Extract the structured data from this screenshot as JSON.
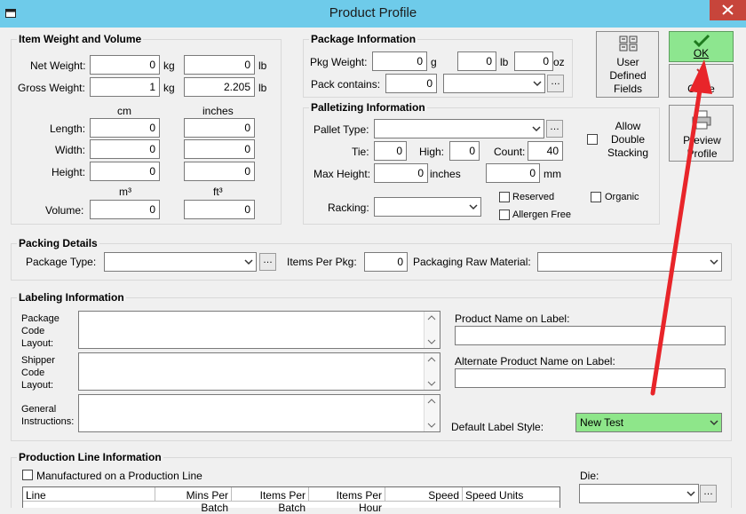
{
  "window": {
    "title": "Product Profile"
  },
  "item_weight": {
    "title": "Item Weight and Volume",
    "net_label": "Net Weight:",
    "net_kg": "0",
    "net_lb": "0",
    "gross_label": "Gross Weight:",
    "gross_kg": "1",
    "gross_lb": "2.205",
    "kg": "kg",
    "lb": "lb",
    "cm": "cm",
    "inches": "inches",
    "length_label": "Length:",
    "length_cm": "0",
    "length_in": "0",
    "width_label": "Width:",
    "width_cm": "0",
    "width_in": "0",
    "height_label": "Height:",
    "height_cm": "0",
    "height_in": "0",
    "m3": "m³",
    "ft3": "ft³",
    "volume_label": "Volume:",
    "volume_m3": "0",
    "volume_ft3": "0"
  },
  "package_info": {
    "title": "Package Information",
    "pkg_weight_label": "Pkg Weight:",
    "g_val": "0",
    "g": "g",
    "lb_val": "0",
    "lb": "lb",
    "oz_val": "0",
    "oz": "oz",
    "pack_contains_label": "Pack contains:",
    "pack_contains_val": "0"
  },
  "palletizing": {
    "title": "Palletizing Information",
    "pallet_type_label": "Pallet Type:",
    "allow_double": "Allow Double Stacking",
    "tie_label": "Tie:",
    "tie_val": "0",
    "high_label": "High:",
    "high_val": "0",
    "count_label": "Count:",
    "count_val": "40",
    "max_height_label": "Max Height:",
    "max_height_in": "0",
    "inches": "inches",
    "max_height_mm": "0",
    "mm": "mm",
    "racking_label": "Racking:",
    "reserved": "Reserved",
    "organic": "Organic",
    "allergen_free": "Allergen Free"
  },
  "buttons": {
    "user_defined": "User Defined Fields",
    "ok": "OK",
    "close": "Close",
    "preview": "Preview Profile"
  },
  "packing": {
    "title": "Packing Details",
    "package_type_label": "Package Type:",
    "items_per_pkg_label": "Items Per Pkg:",
    "items_per_pkg_val": "0",
    "raw_material_label": "Packaging Raw Material:"
  },
  "labeling": {
    "title": "Labeling Information",
    "package_code": "Package Code Layout:",
    "shipper_code": "Shipper Code Layout:",
    "general": "General Instructions:",
    "product_name_label": "Product Name on Label:",
    "alt_name_label": "Alternate Product Name on Label:",
    "default_style_label": "Default Label Style:",
    "default_style_val": "New Test"
  },
  "production": {
    "title": "Production Line Information",
    "manufactured": "Manufactured on a Production Line",
    "die_label": "Die:",
    "columns": [
      "Line",
      "Mins Per Batch",
      "Items Per Batch",
      "Items Per Hour",
      "Speed",
      "Speed Units"
    ]
  },
  "colors": {
    "titlebar": "#6ecbea",
    "ok_green": "#8de68f",
    "label_style_green": "#8ee68a",
    "arrow_red": "#e8252a"
  }
}
